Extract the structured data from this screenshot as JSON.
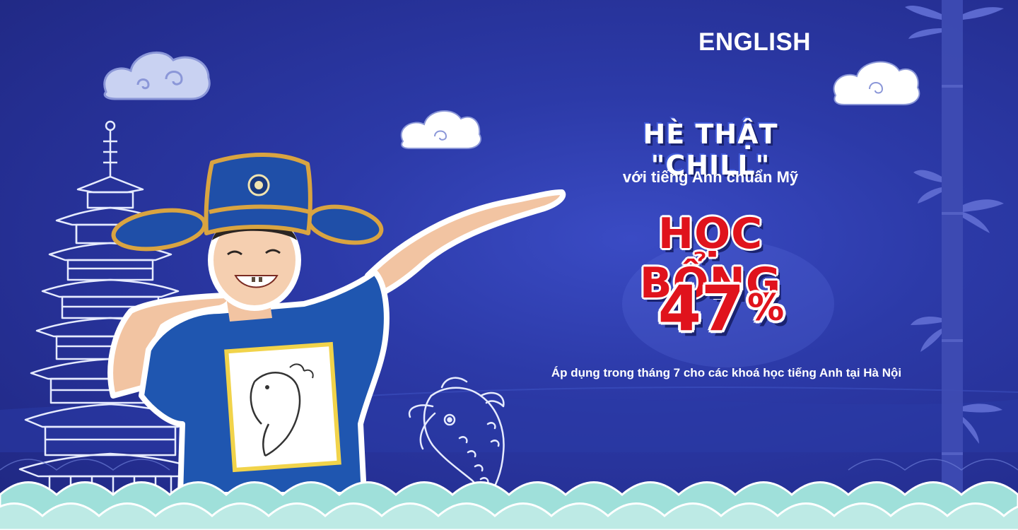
{
  "brand": {
    "label": "ENGLISH"
  },
  "promo": {
    "headline": "HÈ THẬT \"CHILL\"",
    "subheadline": "với tiếng Anh chuẩn Mỹ",
    "scholarship": "HỌC BỔNG",
    "percent_value": "47",
    "percent_sign": "%",
    "note": "Áp dụng trong tháng 7 cho các khoá học tiếng Anh tại Hà Nội"
  },
  "colors": {
    "background": "#2c3aa8",
    "accent_red": "#e0131c",
    "wave_teal": "#9fe0da",
    "shirt_blue": "#1f56b0"
  },
  "icons": [
    "cloud-icon",
    "pagoda-icon",
    "koi-fish-icon",
    "bamboo-icon",
    "wave-pattern-icon"
  ]
}
